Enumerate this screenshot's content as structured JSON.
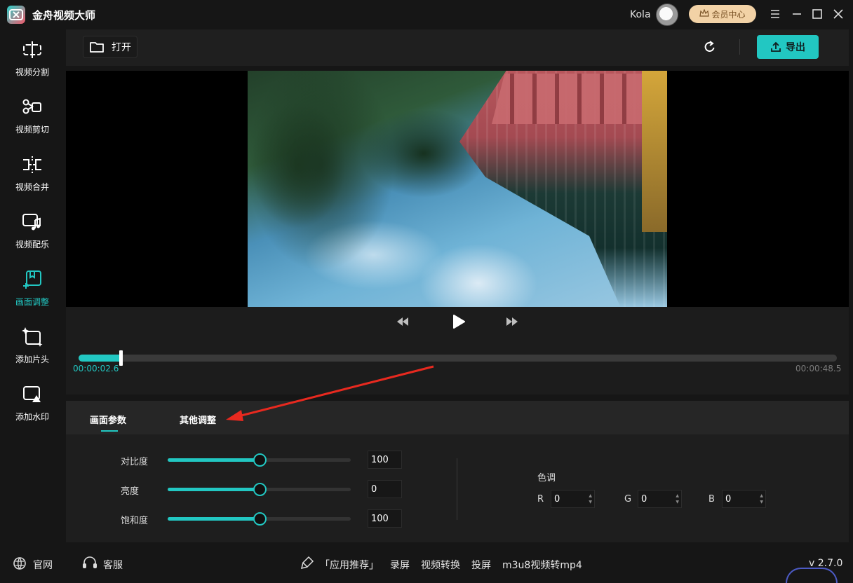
{
  "app": {
    "title": "金舟视频大师"
  },
  "header": {
    "username": "Kola",
    "vip_label": "会员中心"
  },
  "sidebar": {
    "items": [
      {
        "label": "视频分割",
        "icon": "split-icon",
        "active": false
      },
      {
        "label": "视频剪切",
        "icon": "scissors-icon",
        "active": false
      },
      {
        "label": "视频合并",
        "icon": "merge-icon",
        "active": false
      },
      {
        "label": "视频配乐",
        "icon": "music-icon",
        "active": false
      },
      {
        "label": "画面调整",
        "icon": "picture-adjust-icon",
        "active": true
      },
      {
        "label": "添加片头",
        "icon": "add-intro-icon",
        "active": false
      },
      {
        "label": "添加水印",
        "icon": "watermark-icon",
        "active": false
      }
    ]
  },
  "toolbar": {
    "open_label": "打开",
    "export_label": "导出"
  },
  "player": {
    "current_time": "00:00:02.6",
    "total_time": "00:00:48.5",
    "progress": 0.054
  },
  "panel": {
    "tabs": [
      {
        "label": "画面参数",
        "active": true
      },
      {
        "label": "其他调整",
        "active": false
      }
    ],
    "sliders": [
      {
        "label": "对比度",
        "value": "100",
        "position": 0.5
      },
      {
        "label": "亮度",
        "value": "0",
        "position": 0.5
      },
      {
        "label": "饱和度",
        "value": "100",
        "position": 0.5
      }
    ],
    "tone": {
      "label": "色调",
      "r_label": "R",
      "r_value": "0",
      "g_label": "G",
      "g_value": "0",
      "b_label": "B",
      "b_value": "0"
    }
  },
  "footer": {
    "website": "官网",
    "support": "客服",
    "recommend": "「应用推荐」",
    "links": [
      "录屏",
      "视频转换",
      "投屏",
      "m3u8视频转mp4"
    ],
    "version": "v 2.7.0"
  },
  "colors": {
    "accent": "#22c7c2",
    "vip_bg": "#f2d2a6",
    "annotation": "#e8291f"
  }
}
